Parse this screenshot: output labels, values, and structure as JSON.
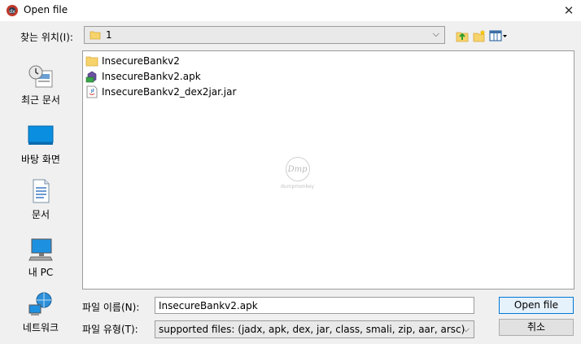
{
  "window": {
    "title": "Open file",
    "close_icon": "close-icon",
    "app_icon": "app-icon"
  },
  "lookin": {
    "label": "찾는 위치(I):",
    "value": "1",
    "folder_icon": "folder-icon"
  },
  "toolbar": {
    "up_icon": "up-one-level-icon",
    "new_folder_icon": "new-folder-icon",
    "view_icon": "view-menu-icon"
  },
  "places": [
    {
      "label": "최근 문서",
      "icon": "recent-items-icon"
    },
    {
      "label": "바탕 화면",
      "icon": "desktop-icon"
    },
    {
      "label": "문서",
      "icon": "documents-icon"
    },
    {
      "label": "내 PC",
      "icon": "this-pc-icon"
    },
    {
      "label": "네트워크",
      "icon": "network-icon"
    }
  ],
  "files": [
    {
      "name": "InsecureBankv2",
      "icon": "folder-icon"
    },
    {
      "name": "InsecureBankv2.apk",
      "icon": "apk-file-icon"
    },
    {
      "name": "InsecureBankv2_dex2jar.jar",
      "icon": "jar-file-icon"
    }
  ],
  "watermark": {
    "logo": "Dmp",
    "text": "dumpmonkey"
  },
  "bottom": {
    "filename_label": "파일 이름(N):",
    "filename_value": "InsecureBankv2.apk",
    "filetype_label": "파일 유형(T):",
    "filetype_value": "supported files: (jadx, apk, dex, jar, class, smali, zip, aar, arsc)",
    "open_label": "Open file",
    "cancel_label": "취소"
  },
  "colors": {
    "folder": "#f6d36b",
    "accent": "#0078d7",
    "desktop": "#0a8fe0"
  }
}
